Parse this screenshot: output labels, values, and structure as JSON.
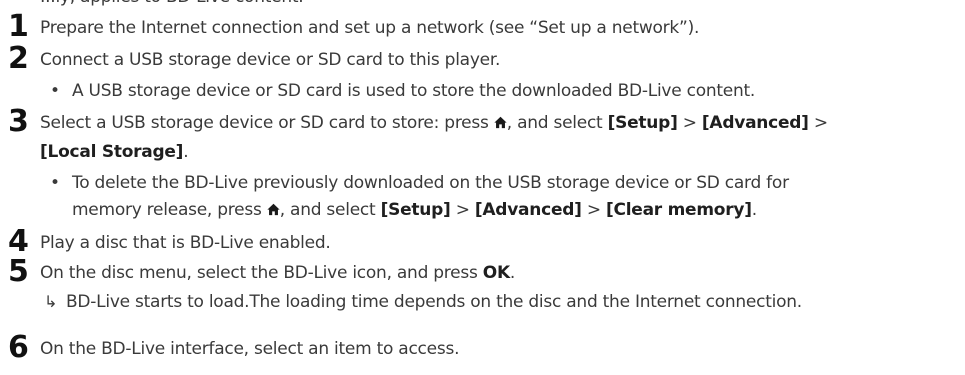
{
  "top_fragment": "...ly, applies to BD-Live content.",
  "steps": [
    {
      "num": "1",
      "text": "Prepare the Internet connection and set up a network (see “Set up a network”)."
    },
    {
      "num": "2",
      "text": "Connect a USB storage device or SD card to this player.",
      "bullet": "A USB storage device or SD card is used to store the downloaded BD-Live content."
    },
    {
      "num": "3",
      "text_a": "Select a USB storage device or SD card to store: press ",
      "text_b": ", and select ",
      "setup": "[Setup]",
      "gt": ">",
      "advanced": "[Advanced]",
      "local_storage": "[Local Storage]",
      "period": ".",
      "bullet_a": "To delete the BD-Live previously downloaded on the USB storage device or SD card for",
      "bullet_b1": "memory release, press ",
      "bullet_b2": ", and select ",
      "clear_memory": "[Clear memory]"
    },
    {
      "num": "4",
      "text": "Play a disc that is BD-Live enabled."
    },
    {
      "num": "5",
      "text_a": "On the disc menu, select the BD-Live icon, and press ",
      "ok": "OK",
      "period": ".",
      "arrow_glyph": "↳",
      "result": "BD-Live starts to load.The loading time depends on the disc and the Internet connection."
    },
    {
      "num": "6",
      "text": "On the BD-Live interface, select an item to access."
    }
  ],
  "icons": {
    "home": "home-icon",
    "bullet": "•"
  }
}
